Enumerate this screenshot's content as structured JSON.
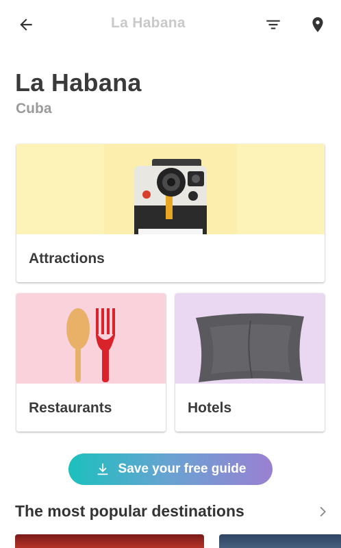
{
  "header": {
    "title": "La Habana",
    "back_icon": "back-arrow-icon",
    "filter_icon": "filter-icon",
    "map_icon": "map-pin-icon"
  },
  "destination": {
    "city": "La Habana",
    "country": "Cuba"
  },
  "categories": [
    {
      "label": "Attractions",
      "icon": "instant-camera-icon",
      "color": "#fdf2b8"
    },
    {
      "label": "Restaurants",
      "icon": "spoon-fork-icon",
      "color": "#f9d2dc"
    },
    {
      "label": "Hotels",
      "icon": "pillow-icon",
      "color": "#ead8f2"
    }
  ],
  "save_guide": {
    "label": "Save your free guide",
    "icon": "download-icon"
  },
  "popular": {
    "title": "The most popular destinations",
    "more_icon": "chevron-right-icon"
  }
}
